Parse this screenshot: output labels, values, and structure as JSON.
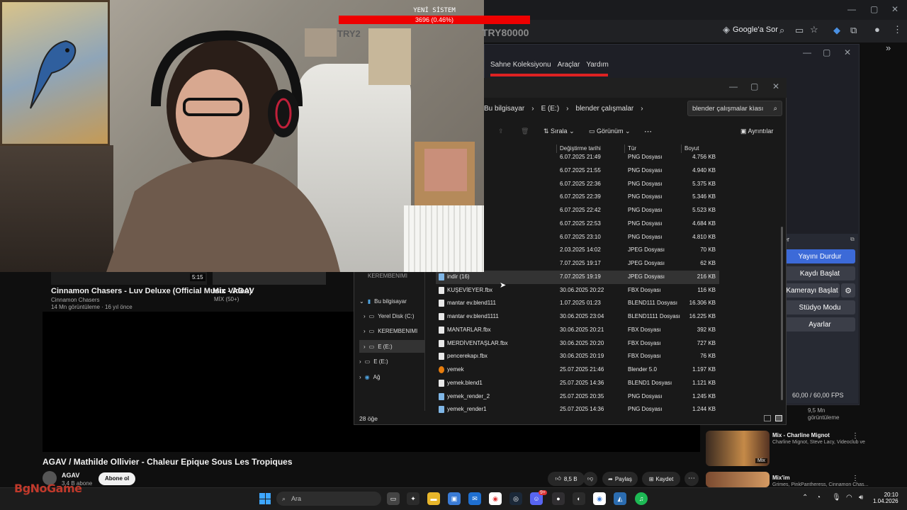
{
  "stream": {
    "sub_goal_title": "YENİ SİSTEM",
    "sub_goal_progress": "3696 (0.46%)",
    "try_label": "TRY2",
    "try_counter": "TRY80000",
    "watermark": "BgNoGame"
  },
  "browser": {
    "google_sor": "Google'a Sor",
    "window_controls": [
      "—",
      "▢",
      "✕"
    ]
  },
  "youtube": {
    "thumb1_duration": "5:15",
    "thumb1_title": "Cinnamon Chasers - Luv Deluxe (Official Music Video)",
    "thumb1_channel": "Cinnamon Chasers",
    "thumb1_meta": "14 Mn görüntüleme · 16 yıl önce",
    "thumb2_title": "Mix - AGAV",
    "thumb2_meta": "MİX (50+)",
    "video_title": "AGAV / Mathilde Ollivier - Chaleur Epique Sous Les Tropiques",
    "channel_name": "AGAV",
    "channel_subs": "3,4 B abone",
    "subscribe": "Abone ol",
    "likes": "8,5 B",
    "share": "Paylaş",
    "save": "Kaydet",
    "side_views": "9,5 Mn",
    "side_views2": "görüntüleme",
    "side1_title": "Mix - Charline Mignot",
    "side1_meta": "Charline Mignot, Steve Lacy, Videoclub ve",
    "side1_badge": "Mix",
    "side2_title": "Mix'im",
    "side2_meta": "Grimes, PinkPantheress, Cinnamon Chas..."
  },
  "obs": {
    "menu": [
      "Sahne Koleksiyonu",
      "Araçlar",
      "Yardım"
    ],
    "stop_stream": "Yayını Durdur",
    "start_record": "Kaydı Başlat",
    "start_camera": "Kamerayı Başlat",
    "studio_mode": "Stüdyo Modu",
    "settings": "Ayarlar",
    "fps": "60,00 / 60,00 FPS",
    "panel_label": "er"
  },
  "explorer": {
    "address": [
      "Bu bilgisayar",
      "E (E:)",
      "blender çalışmalar"
    ],
    "search_placeholder": "blender çalışmalar kìası",
    "sort": "Sırala",
    "view": "Görünüm",
    "details": "Ayrıntılar",
    "columns": [
      "Değiştirme tarihi",
      "Tür",
      "Boyut"
    ],
    "rows": [
      {
        "name": "",
        "date": "6.07.2025 21:49",
        "type": "PNG Dosyası",
        "size": "4.756 KB"
      },
      {
        "name": "",
        "date": "6.07.2025 21:55",
        "type": "PNG Dosyası",
        "size": "4.940 KB"
      },
      {
        "name": "",
        "date": "6.07.2025 22:36",
        "type": "PNG Dosyası",
        "size": "5.375 KB"
      },
      {
        "name": "",
        "date": "6.07.2025 22:39",
        "type": "PNG Dosyası",
        "size": "5.346 KB"
      },
      {
        "name": "",
        "date": "6.07.2025 22:42",
        "type": "PNG Dosyası",
        "size": "5.523 KB"
      },
      {
        "name": "",
        "date": "6.07.2025 22:53",
        "type": "PNG Dosyası",
        "size": "4.684 KB"
      },
      {
        "name": "",
        "date": "6.07.2025 23:10",
        "type": "PNG Dosyası",
        "size": "4.810 KB"
      },
      {
        "name": "",
        "date": "2.03.2025 14:02",
        "type": "JPEG Dosyası",
        "size": "70 KB"
      },
      {
        "name": "",
        "date": "7.07.2025 19:17",
        "type": "JPEG Dosyası",
        "size": "62 KB"
      },
      {
        "name": "indir (16)",
        "date": "7.07.2025 19:19",
        "type": "JPEG Dosyası",
        "size": "216 KB"
      },
      {
        "name": "KUŞEVİEYER.fbx",
        "date": "30.06.2025 20:22",
        "type": "FBX Dosyası",
        "size": "116 KB"
      },
      {
        "name": "mantar ev.blend111",
        "date": "1.07.2025 01:23",
        "type": "BLEND111 Dosyası",
        "size": "16.306 KB"
      },
      {
        "name": "mantar ev.blend1111",
        "date": "30.06.2025 23:04",
        "type": "BLEND1111 Dosyası",
        "size": "16.225 KB"
      },
      {
        "name": "MANTARLAR.fbx",
        "date": "30.06.2025 20:21",
        "type": "FBX Dosyası",
        "size": "392 KB"
      },
      {
        "name": "MERDİVENTAŞLAR.fbx",
        "date": "30.06.2025 20:20",
        "type": "FBX Dosyası",
        "size": "727 KB"
      },
      {
        "name": "pencerekapı.fbx",
        "date": "30.06.2025 20:19",
        "type": "FBX Dosyası",
        "size": "76 KB"
      },
      {
        "name": "yemek",
        "date": "25.07.2025 21:46",
        "type": "Blender 5.0",
        "size": "1.197 KB"
      },
      {
        "name": "yemek.blend1",
        "date": "25.07.2025 14:36",
        "type": "BLEND1 Dosyası",
        "size": "1.121 KB"
      },
      {
        "name": "yemek_render_2",
        "date": "25.07.2025 20:35",
        "type": "PNG Dosyası",
        "size": "1.245 KB"
      },
      {
        "name": "yemek_render1",
        "date": "25.07.2025 14:36",
        "type": "PNG Dosyası",
        "size": "1.244 KB"
      }
    ],
    "nav": {
      "this_pc": "Bu bilgisayar",
      "local_disk": "Yerel Disk (C:)",
      "kerem": "KEREMBENIMI",
      "drive_e": "E (E:)",
      "drive_e2": "E (E:)",
      "network": "Ağ",
      "partial": "KEREMBENIMI"
    },
    "item_count": "28 öğe"
  },
  "taskbar": {
    "search": "Ara",
    "time": "20:10",
    "date": "1.04.2026",
    "badge_discord": "9+"
  }
}
